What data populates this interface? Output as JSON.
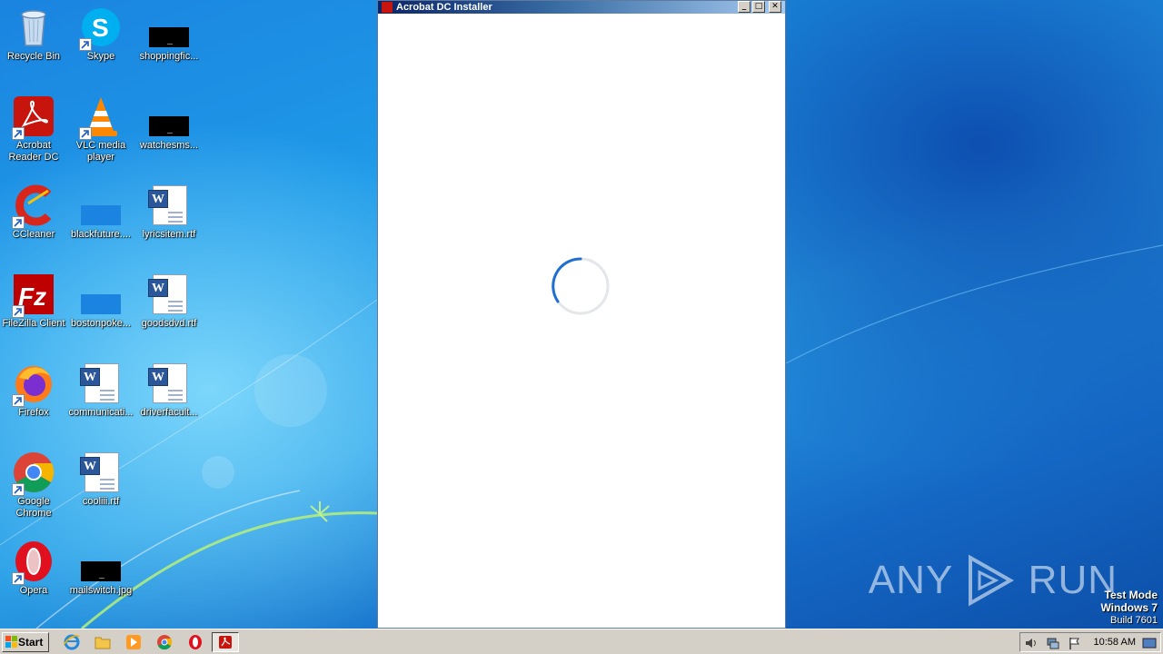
{
  "desktop": {
    "icons": [
      {
        "label": "Recycle Bin"
      },
      {
        "label": "Skype"
      },
      {
        "label": "shoppingfic..."
      },
      {
        "label": "Acrobat Reader DC"
      },
      {
        "label": "VLC media player"
      },
      {
        "label": "watchesms..."
      },
      {
        "label": "CCleaner"
      },
      {
        "label": "blackfuture...."
      },
      {
        "label": "lyricsitem.rtf"
      },
      {
        "label": "FileZilla Client"
      },
      {
        "label": "bostonpoke..."
      },
      {
        "label": "goodsdvd.rtf"
      },
      {
        "label": "Firefox"
      },
      {
        "label": "communicati..."
      },
      {
        "label": "driverfacult..."
      },
      {
        "label": "Google Chrome"
      },
      {
        "label": "cooliii.rtf"
      },
      {
        "label": "Opera"
      },
      {
        "label": "mailswitch.jpg"
      }
    ]
  },
  "installer": {
    "title": "Acrobat DC Installer",
    "status": "loading"
  },
  "watermark": {
    "brand_left": "ANY",
    "brand_right": "RUN",
    "mode": "Test Mode",
    "os": "Windows 7",
    "build": "Build 7601"
  },
  "taskbar": {
    "start_label": "Start",
    "clock": "10:58 AM"
  },
  "colors": {
    "accent_blue": "#1a84e0",
    "acrobat_red": "#c7140c",
    "spinner_blue": "#1f6fd0"
  }
}
